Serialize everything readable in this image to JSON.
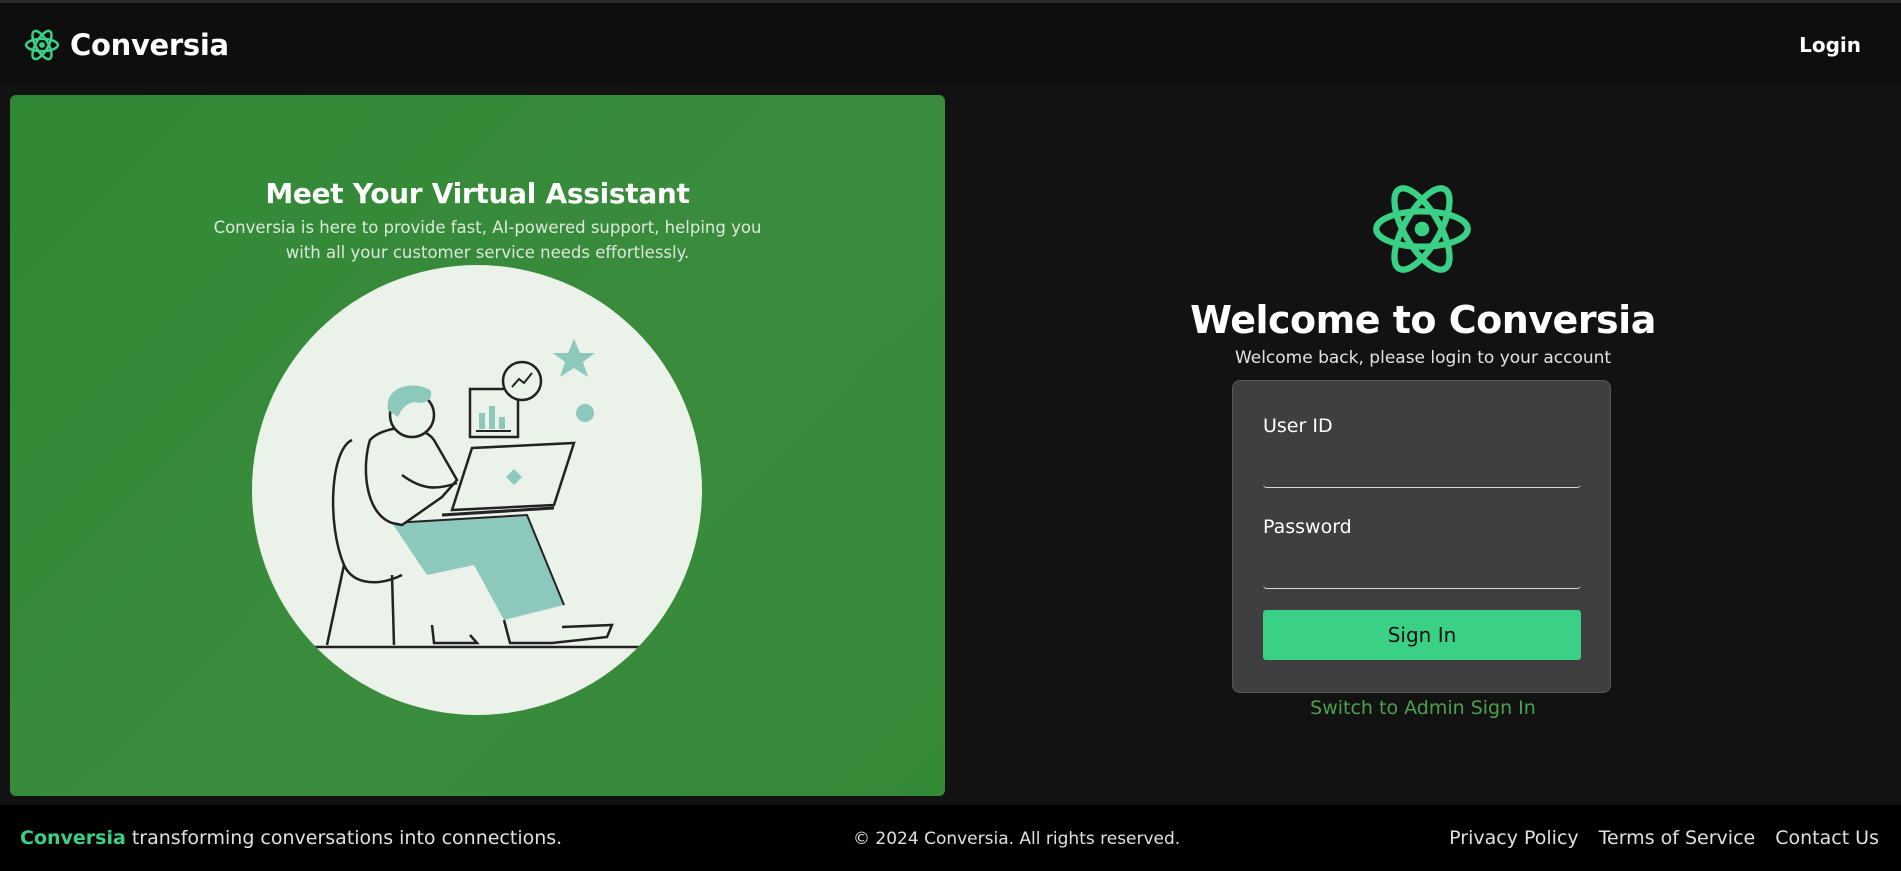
{
  "brand": {
    "name": "Conversia",
    "icon": "atom-logo-icon",
    "color": "#3ad085"
  },
  "nav": {
    "login_label": "Login"
  },
  "hero": {
    "title": "Meet Your Virtual Assistant",
    "subtitle": "Conversia is here to provide fast, AI-powered support, helping you with all your customer service needs effortlessly.",
    "illustration": "person-with-laptop-illustration",
    "background": "#388a3a"
  },
  "login": {
    "title": "Welcome to Conversia",
    "subtitle": "Welcome back, please login to your account",
    "user_id_label": "User ID",
    "user_id_value": "",
    "password_label": "Password",
    "password_value": "",
    "submit_label": "Sign In",
    "switch_admin_label": "Switch to Admin Sign In",
    "button_color": "#3ad085"
  },
  "footer": {
    "brand": "Conversia",
    "tagline": " transforming conversations into connections.",
    "copyright": "© 2024 Conversia. All rights reserved.",
    "links": [
      "Privacy Policy",
      "Terms of Service",
      "Contact Us"
    ]
  }
}
